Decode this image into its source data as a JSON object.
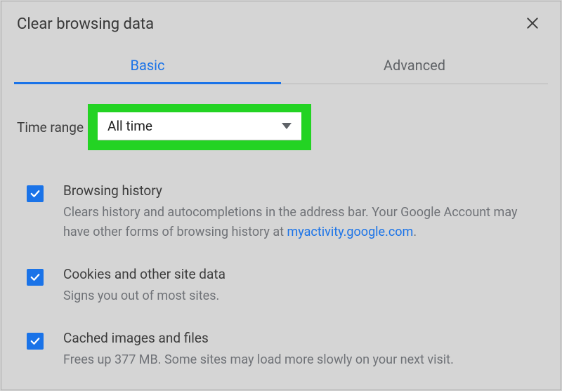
{
  "dialog": {
    "title": "Clear browsing data"
  },
  "tabs": {
    "basic": "Basic",
    "advanced": "Advanced"
  },
  "timeRange": {
    "label": "Time range",
    "selected": "All time"
  },
  "options": {
    "browsingHistory": {
      "title": "Browsing history",
      "desc1": "Clears history and autocompletions in the address bar. Your Google Account may have other forms of browsing history at ",
      "link": "myactivity.google.com",
      "desc2": "."
    },
    "cookies": {
      "title": "Cookies and other site data",
      "desc": "Signs you out of most sites."
    },
    "cache": {
      "title": "Cached images and files",
      "desc": "Frees up 377 MB. Some sites may load more slowly on your next visit."
    }
  }
}
